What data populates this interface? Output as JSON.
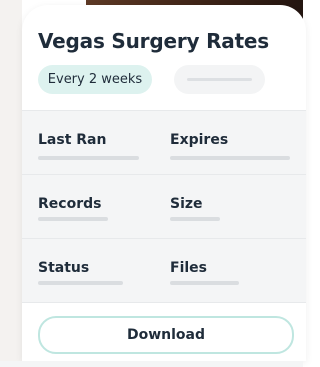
{
  "card": {
    "title": "Vegas Surgery Rates",
    "frequency_chip": "Every 2 weeks",
    "fields": [
      {
        "label": "Last Ran"
      },
      {
        "label": "Expires"
      },
      {
        "label": "Records"
      },
      {
        "label": "Size"
      },
      {
        "label": "Status"
      },
      {
        "label": "Files"
      }
    ],
    "download_label": "Download"
  },
  "colors": {
    "title_text": "#1f2c3a",
    "chip_bg": "#ddf2ef",
    "section_bg": "#f4f5f6",
    "placeholder_bar": "#dadde0",
    "button_border": "#bfe6e0"
  }
}
